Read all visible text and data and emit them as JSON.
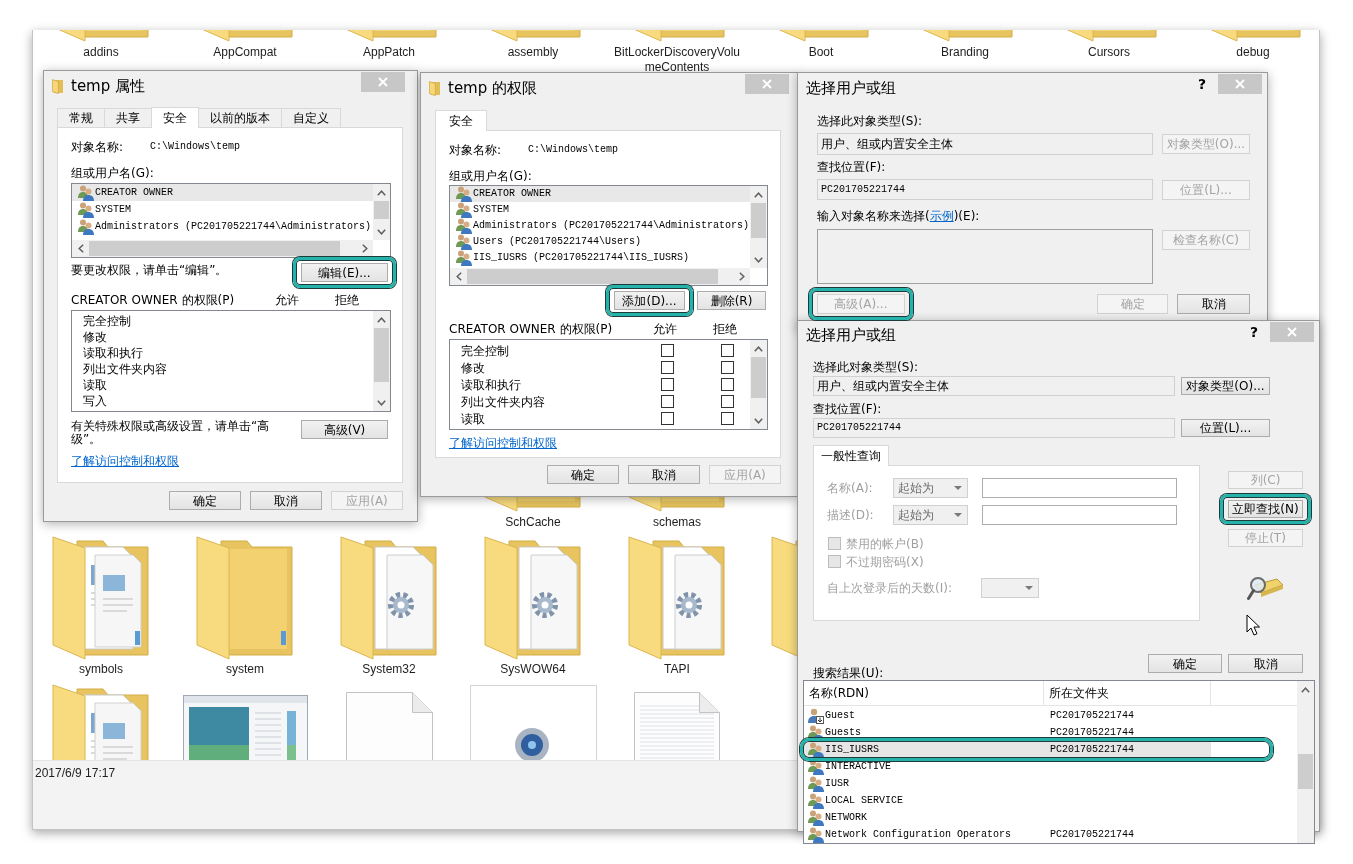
{
  "explorer": {
    "rows": [
      {
        "items": [
          {
            "kind": "folder",
            "label": "addins"
          },
          {
            "kind": "folder",
            "label": "AppCompat"
          },
          {
            "kind": "folder",
            "label": "AppPatch"
          },
          {
            "kind": "folder",
            "label": "assembly"
          },
          {
            "kind": "folder",
            "label": "BitLockerDiscoveryVolumeContents"
          },
          {
            "kind": "folder",
            "label": "Boot"
          },
          {
            "kind": "folder",
            "label": "Branding"
          },
          {
            "kind": "folder",
            "label": "Cursors"
          },
          {
            "kind": "folder",
            "label": "debug"
          }
        ]
      },
      {
        "items": [
          {
            "kind": "folder",
            "label": "SchCache"
          },
          {
            "kind": "folder",
            "label": "schemas"
          }
        ]
      },
      {
        "items": [
          {
            "kind": "folder-documents",
            "label": "symbols"
          },
          {
            "kind": "folder",
            "label": "system"
          },
          {
            "kind": "folder-gear",
            "label": "System32"
          },
          {
            "kind": "folder-gear",
            "label": "SysWOW64"
          },
          {
            "kind": "folder-gear",
            "label": "TAPI"
          },
          {
            "kind": "folder"
          }
        ]
      },
      {
        "items": [
          {
            "kind": "folder-documents"
          },
          {
            "kind": "window-thumbnail"
          },
          {
            "kind": "blank-file"
          },
          {
            "kind": "webcam-file"
          },
          {
            "kind": "text-file"
          }
        ]
      }
    ],
    "status_bar": "2017/6/9 17:17"
  },
  "dialogs": [
    {
      "kind": "properties",
      "title": "temp 属性",
      "tabs": [
        {
          "label": "常规",
          "selected": false
        },
        {
          "label": "共享",
          "selected": false
        },
        {
          "label": "安全",
          "selected": true
        },
        {
          "label": "以前的版本",
          "selected": false
        },
        {
          "label": "自定义",
          "selected": false
        }
      ],
      "object_label": "对象名称:",
      "object_name": "C:\\Windows\\temp",
      "groups_label": "组或用户名(G):",
      "groups": [
        {
          "name": "CREATOR OWNER",
          "selected": true
        },
        {
          "name": "SYSTEM",
          "selected": false
        },
        {
          "name": "Administrators (PC201705221744\\Administrators)",
          "selected": false
        }
      ],
      "edit_hint": "要更改权限，请单击“编辑”。",
      "edit_button": {
        "label": "编辑(E)...",
        "disabled": false,
        "highlighted": true
      },
      "permissions_label": "CREATOR OWNER 的权限(P)",
      "allow_label": "允许",
      "deny_label": "拒绝",
      "permissions": [
        {
          "name": "完全控制"
        },
        {
          "name": "修改"
        },
        {
          "name": "读取和执行"
        },
        {
          "name": "列出文件夹内容"
        },
        {
          "name": "读取"
        },
        {
          "name": "写入"
        }
      ],
      "advanced_hint": "有关特殊权限或高级设置，请单击“高级”。",
      "advanced_button": {
        "label": "高级(V)",
        "disabled": false
      },
      "link": "了解访问控制和权限",
      "buttons": [
        {
          "label": "确定",
          "disabled": false
        },
        {
          "label": "取消",
          "disabled": false
        },
        {
          "label": "应用(A)",
          "disabled": true
        }
      ]
    },
    {
      "kind": "permissions",
      "title": "temp 的权限",
      "tabs": [
        {
          "label": "安全",
          "selected": true
        }
      ],
      "object_label": "对象名称:",
      "object_name": "C:\\Windows\\temp",
      "groups_label": "组或用户名(G):",
      "groups": [
        {
          "name": "CREATOR OWNER",
          "selected": true
        },
        {
          "name": "SYSTEM",
          "selected": false
        },
        {
          "name": "Administrators (PC201705221744\\Administrators)",
          "selected": false
        },
        {
          "name": "Users (PC201705221744\\Users)",
          "selected": false
        },
        {
          "name": "IIS_IUSRS (PC201705221744\\IIS_IUSRS)",
          "selected": false
        }
      ],
      "add_button": {
        "label": "添加(D)...",
        "disabled": false,
        "highlighted": true
      },
      "remove_button": {
        "label": "删除(R)",
        "disabled": false
      },
      "permissions_label": "CREATOR OWNER 的权限(P)",
      "allow_label": "允许",
      "deny_label": "拒绝",
      "permissions": [
        {
          "name": "完全控制",
          "allow": false,
          "deny": false
        },
        {
          "name": "修改",
          "allow": false,
          "deny": false
        },
        {
          "name": "读取和执行",
          "allow": false,
          "deny": false
        },
        {
          "name": "列出文件夹内容",
          "allow": false,
          "deny": false
        },
        {
          "name": "读取",
          "allow": false,
          "deny": false
        }
      ],
      "link": "了解访问控制和权限",
      "buttons": [
        {
          "label": "确定",
          "disabled": false
        },
        {
          "label": "取消",
          "disabled": false
        },
        {
          "label": "应用(A)",
          "disabled": true
        }
      ]
    },
    {
      "kind": "select",
      "title": "选择用户或组",
      "help": "?",
      "type_label": "选择此对象类型(S):",
      "type_value": "用户、组或内置安全主体",
      "type_button": {
        "label": "对象类型(O)...",
        "disabled": true
      },
      "location_label": "查找位置(F):",
      "location_value": "PC201705221744",
      "location_button": {
        "label": "位置(L)...",
        "disabled": true
      },
      "names_label": {
        "before": "输入对象名称来选择(",
        "link": "示例",
        "after": ")(E):"
      },
      "names_field": {
        "disabled": true
      },
      "check_button": {
        "label": "检查名称(C)",
        "disabled": true
      },
      "advanced_button": {
        "label": "高级(A)...",
        "disabled": true,
        "highlighted": true
      },
      "buttons": [
        {
          "label": "确定",
          "disabled": true
        },
        {
          "label": "取消",
          "disabled": false
        }
      ]
    },
    {
      "kind": "select-advanced",
      "title": "选择用户或组",
      "help": "?",
      "type_label": "选择此对象类型(S):",
      "type_value": "用户、组或内置安全主体",
      "type_button": {
        "label": "对象类型(O)...",
        "disabled": false
      },
      "location_label": "查找位置(F):",
      "location_value": "PC201705221744",
      "location_button": {
        "label": "位置(L)...",
        "disabled": false
      },
      "query_tabs": [
        {
          "label": "一般性查询",
          "selected": true
        }
      ],
      "query": {
        "disabled": true,
        "name_label": "名称(A):",
        "name_mode": "起始为",
        "description_label": "描述(D):",
        "description_mode": "起始为",
        "options": [
          {
            "label": "禁用的帐户(B)",
            "checked": false
          },
          {
            "label": "不过期密码(X)",
            "checked": false
          }
        ],
        "days_label": "自上次登录后的天数(I):"
      },
      "side_buttons": [
        {
          "label": "列(C)",
          "disabled": true,
          "highlighted": false
        },
        {
          "label": "立即查找(N)",
          "disabled": false,
          "highlighted": true
        },
        {
          "label": "停止(T)",
          "disabled": true,
          "highlighted": false
        }
      ],
      "buttons": [
        {
          "label": "确定",
          "disabled": false
        },
        {
          "label": "取消",
          "disabled": false
        }
      ],
      "results": {
        "label": "搜索结果(U):",
        "columns": [
          "名称(RDN)",
          "所在文件夹"
        ],
        "rows": [
          {
            "kind": "user",
            "name": "Guest",
            "folder": "PC201705221744",
            "selected": false,
            "highlighted": false
          },
          {
            "kind": "group",
            "name": "Guests",
            "folder": "PC201705221744",
            "selected": false,
            "highlighted": false
          },
          {
            "kind": "group",
            "name": "IIS_IUSRS",
            "folder": "PC201705221744",
            "selected": true,
            "highlighted": true
          },
          {
            "kind": "group",
            "name": "INTERACTIVE",
            "selected": false,
            "highlighted": false
          },
          {
            "kind": "group",
            "name": "IUSR",
            "selected": false,
            "highlighted": false
          },
          {
            "kind": "group",
            "name": "LOCAL SERVICE",
            "selected": false,
            "highlighted": false
          },
          {
            "kind": "group",
            "name": "NETWORK",
            "selected": false,
            "highlighted": false
          },
          {
            "kind": "group",
            "name": "Network Configuration Operators",
            "folder": "PC201705221744",
            "selected": false,
            "highlighted": false
          }
        ]
      }
    }
  ]
}
